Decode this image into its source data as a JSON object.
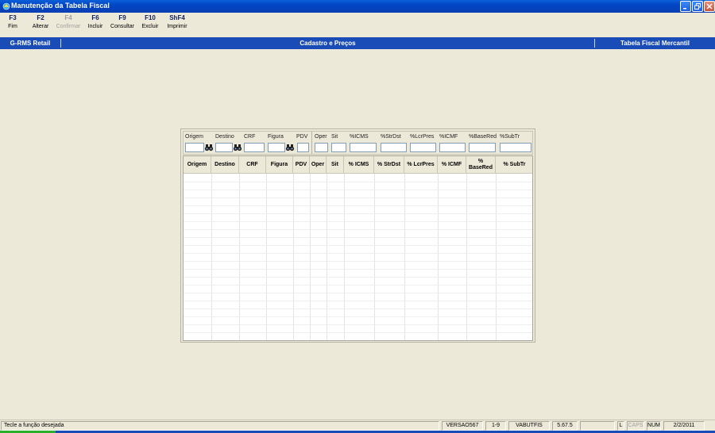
{
  "window": {
    "title": "Manutenção da Tabela Fiscal"
  },
  "toolbar": [
    {
      "key": "F3",
      "label": "Fim",
      "enabled": true
    },
    {
      "key": "F2",
      "label": "Alterar",
      "enabled": true
    },
    {
      "key": "F4",
      "label": "Confirmar",
      "enabled": false
    },
    {
      "key": "F6",
      "label": "Incluir",
      "enabled": true
    },
    {
      "key": "F9",
      "label": "Consultar",
      "enabled": true
    },
    {
      "key": "F10",
      "label": "Excluir",
      "enabled": true
    },
    {
      "key": "ShF4",
      "label": "Imprimir",
      "enabled": true
    }
  ],
  "modbar": {
    "system": "G-RMS Retail",
    "module": "Cadastro e Preços",
    "context": "Tabela Fiscal Mercantil"
  },
  "filters": {
    "origem": "Origem",
    "destino": "Destino",
    "crf": "CRF",
    "figura": "Figura",
    "pdv": "PDV",
    "oper": "Oper",
    "sit": "Sit",
    "icms": "%ICMS",
    "strdst": "%StrDst",
    "lcrpres": "%LcrPres",
    "icmf": "%ICMF",
    "basered": "%BaseRed",
    "subtr": "%SubTr"
  },
  "grid": {
    "columns": [
      "Origem",
      "Destino",
      "CRF",
      "Figura",
      "PDV",
      "Oper",
      "Sit",
      "% ICMS",
      "% StrDst",
      "% LcrPres",
      "% ICMF",
      "% BaseRed",
      "% SubTr"
    ]
  },
  "status": {
    "message": "Tecle a função desejada",
    "version": "VERSAO567",
    "range": "1-9",
    "program": "VABUTFIS",
    "build": "5.67.5",
    "lock": "L",
    "caps": "CAPS",
    "num": "NUM",
    "date": "2/2/2011"
  },
  "colors": {
    "titlebar": "#0245c4",
    "modbar": "#1a4cb8",
    "background": "#ece9d8",
    "accent_key": "#10215e"
  }
}
